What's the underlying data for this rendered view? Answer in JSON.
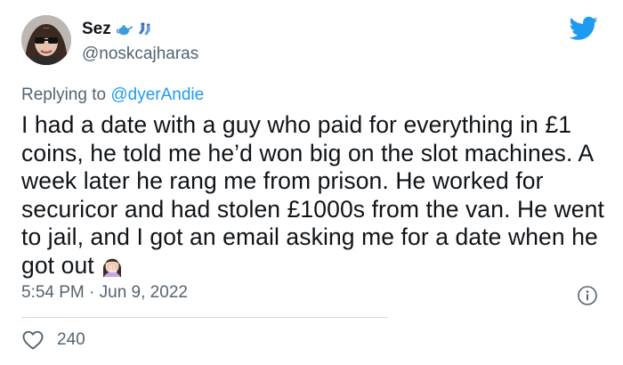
{
  "user": {
    "display_name": "Sez",
    "handle": "@noskcajharas",
    "name_emojis": [
      "teapot-icon",
      "socks-icon"
    ]
  },
  "reply": {
    "prefix": "Replying to ",
    "mention": "@dyerAndie"
  },
  "tweet": {
    "text": "I had a date with a guy who paid for everything in £1 coins, he told me he’d won big on the slot machines. A week later he rang me from prison. He worked for securicor and had stolen £1000s from the van. He went to jail, and I got an email asking me for a date when he got out",
    "trailing_emoji": "facepalm-woman-icon"
  },
  "meta": {
    "timestamp": "5:54 PM · Jun 9, 2022"
  },
  "stats": {
    "likes": "240"
  },
  "colors": {
    "brand_blue": "#1d9bf0",
    "secondary_text": "#536471",
    "primary_text": "#0f1419",
    "divider": "#cfd9de"
  }
}
